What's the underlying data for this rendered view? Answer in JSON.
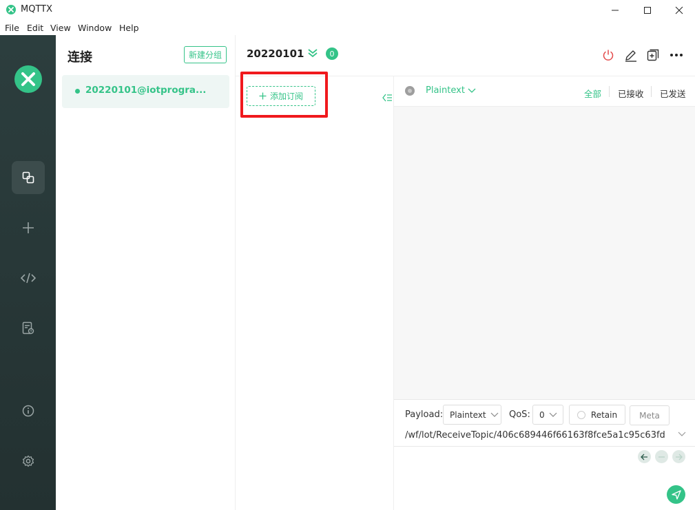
{
  "window": {
    "title": "MQTTX",
    "controls": [
      "minimize",
      "maximize",
      "close"
    ]
  },
  "menu": [
    "File",
    "Edit",
    "View",
    "Window",
    "Help"
  ],
  "nav": {
    "items": [
      {
        "icon": "connections-icon",
        "active": true
      },
      {
        "icon": "plus-icon",
        "active": false
      },
      {
        "icon": "code-icon",
        "active": false
      },
      {
        "icon": "log-icon",
        "active": false
      },
      {
        "icon": "info-icon",
        "active": false
      },
      {
        "icon": "gear-icon",
        "active": false
      }
    ]
  },
  "connections": {
    "title": "连接",
    "new_group_label": "新建分组",
    "items": [
      {
        "label": "20220101@iotprogra...",
        "connected": true
      }
    ]
  },
  "header": {
    "connection_name": "20220101",
    "subscription_count": "0"
  },
  "subscriptions": {
    "add_label": "添加订阅"
  },
  "messages": {
    "format": "Plaintext",
    "filters": [
      "全部",
      "已接收",
      "已发送"
    ],
    "active_filter": "全部"
  },
  "publish": {
    "payload_label": "Payload:",
    "payload_format": "Plaintext",
    "qos_label": "QoS:",
    "qos_value": "0",
    "retain_label": "Retain",
    "meta_label": "Meta",
    "topic": "/wf/lot/ReceiveTopic/406c689446f66163f8fce5a1c95c63fd"
  },
  "colors": {
    "accent": "#34c388",
    "nav_bg": "#2c3e3e",
    "highlight": "#f0191d"
  }
}
